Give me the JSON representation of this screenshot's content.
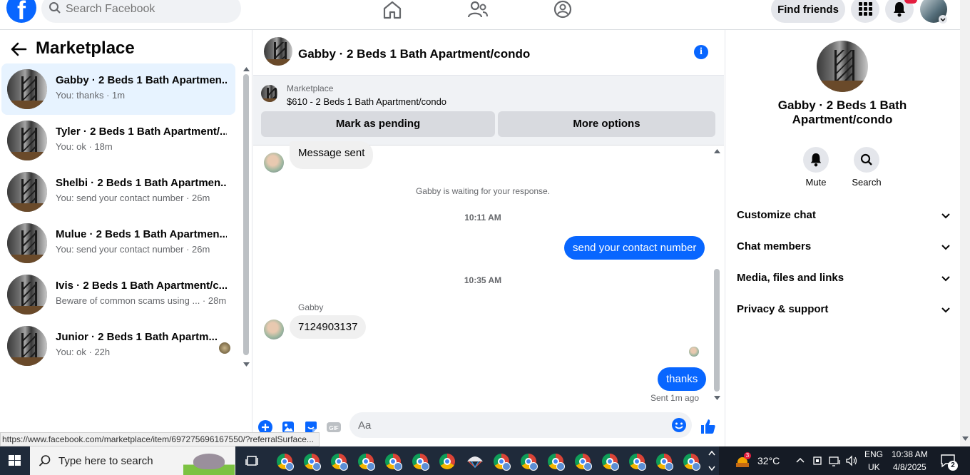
{
  "topbar": {
    "logo_letter": "f",
    "search_placeholder": "Search Facebook",
    "find_friends": "Find friends",
    "notif_count": "2"
  },
  "left": {
    "title": "Marketplace",
    "conversations": [
      {
        "name": "Gabby · 2 Beds 1 Bath Apartmen...",
        "sub": "You: thanks · 1m"
      },
      {
        "name": "Tyler · 2 Beds 1 Bath Apartment/...",
        "sub": "You: ok · 18m"
      },
      {
        "name": "Shelbi · 2 Beds 1 Bath Apartmen...",
        "sub": "You: send your contact number · 26m"
      },
      {
        "name": "Mulue · 2 Beds 1 Bath Apartmen...",
        "sub": "You: send your contact number · 26m"
      },
      {
        "name": "Ivis · 2 Beds 1 Bath Apartment/c...",
        "sub": "Beware of common scams using ... · 28m"
      },
      {
        "name": "Junior · 2 Beds 1 Bath Apartm...",
        "sub": "You: ok · 22h"
      }
    ]
  },
  "chat": {
    "title": "Gabby · 2 Beds 1 Bath Apartment/condo",
    "listing_label": "Marketplace",
    "listing_price": "$610 - 2 Beds 1 Bath Apartment/condo",
    "mark_pending": "Mark as pending",
    "more_options": "More options",
    "msg_sent": "Message sent",
    "waiting": "Gabby is waiting for your response.",
    "time1": "10:11 AM",
    "out1": "send your contact number",
    "time2": "10:35 AM",
    "sender": "Gabby",
    "in1": "7124903137",
    "out2": "thanks",
    "sent_status": "Sent 1m ago",
    "composer_placeholder": "Aa"
  },
  "right": {
    "name": "Gabby · 2 Beds 1 Bath Apartment/condo",
    "mute": "Mute",
    "search": "Search",
    "rows": [
      "Customize chat",
      "Chat members",
      "Media, files and links",
      "Privacy & support"
    ]
  },
  "status_url": "https://www.facebook.com/marketplace/item/697275696167550/?referralSurface...",
  "taskbar": {
    "search_placeholder": "Type here to search",
    "weather_badge": "3",
    "temp": "32°C",
    "lang1": "ENG",
    "lang2": "UK",
    "time": "10:38 AM",
    "date": "4/8/2025",
    "notif_count": "2"
  },
  "colors": {
    "accent": "#0866ff",
    "active_row": "#e7f3ff",
    "taskbar": "#1f2a3a"
  }
}
